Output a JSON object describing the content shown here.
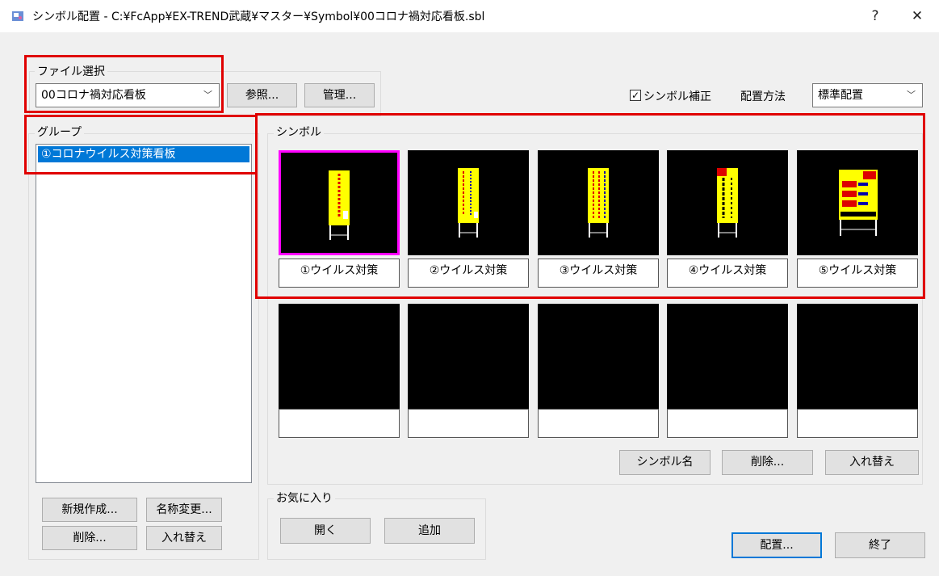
{
  "window": {
    "title": "シンボル配置 - C:¥FcApp¥EX-TREND武蔵¥マスター¥Symbol¥00コロナ禍対応看板.sbl",
    "help_label": "?",
    "close_label": "✕"
  },
  "file_select": {
    "group_label": "ファイル選択",
    "combo_value": "00コロナ禍対応看板",
    "browse_label": "参照...",
    "manage_label": "管理..."
  },
  "options": {
    "symbol_correction_label": "シンボル補正",
    "symbol_correction_checked": true,
    "placement_method_label": "配置方法",
    "placement_method_value": "標準配置"
  },
  "group_panel": {
    "group_label": "グループ",
    "items": [
      "①コロナウイルス対策看板"
    ],
    "new_label": "新規作成...",
    "rename_label": "名称変更...",
    "delete_label": "削除...",
    "swap_label": "入れ替え"
  },
  "symbol_panel": {
    "group_label": "シンボル",
    "symbols": [
      {
        "name": "①ウイルス対策",
        "selected": true
      },
      {
        "name": "②ウイルス対策",
        "selected": false
      },
      {
        "name": "③ウイルス対策",
        "selected": false
      },
      {
        "name": "④ウイルス対策",
        "selected": false
      },
      {
        "name": "⑤ウイルス対策",
        "selected": false
      },
      {
        "name": "",
        "selected": false
      },
      {
        "name": "",
        "selected": false
      },
      {
        "name": "",
        "selected": false
      },
      {
        "name": "",
        "selected": false
      },
      {
        "name": "",
        "selected": false
      }
    ],
    "symbol_name_label": "シンボル名",
    "delete_label": "削除...",
    "swap_label": "入れ替え"
  },
  "favorites": {
    "group_label": "お気に入り",
    "open_label": "開く",
    "add_label": "追加"
  },
  "footer": {
    "place_label": "配置...",
    "exit_label": "終了"
  },
  "colors": {
    "highlight": "#e00000",
    "selection": "#0078d7",
    "selected_cell_border": "#ff00ff",
    "sign_yellow": "#ffff00"
  }
}
